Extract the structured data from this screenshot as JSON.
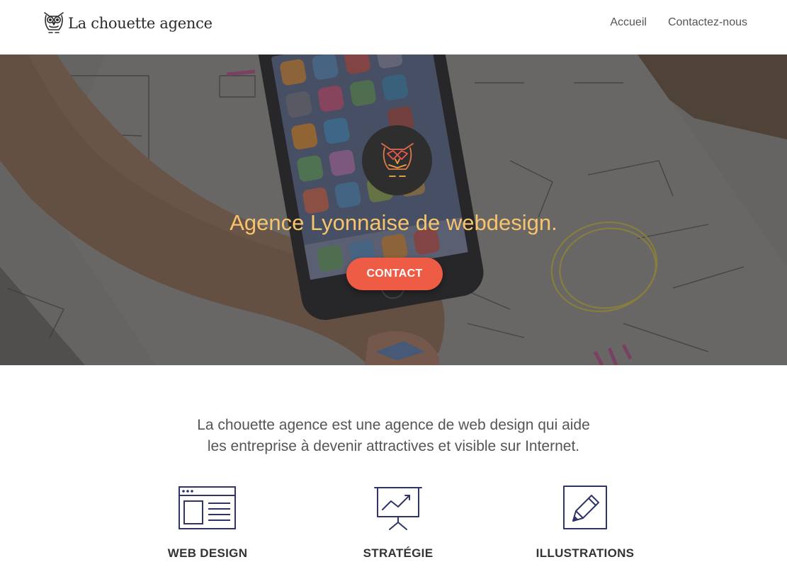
{
  "brand": {
    "name": "La chouette agence",
    "accent_color": "#ee5c45",
    "hero_title_color": "#f7c36b",
    "icon_color": "#2f3566"
  },
  "nav": {
    "items": [
      {
        "label": "Accueil"
      },
      {
        "label": "Contactez-nous"
      }
    ]
  },
  "hero": {
    "title": "Agence Lyonnaise de webdesign.",
    "cta_label": "CONTACT",
    "badge_icon": "owl-icon"
  },
  "intro": {
    "line1": "La chouette agence est une agence de web design qui aide",
    "line2": "les entreprise à devenir attractives et visible sur Internet."
  },
  "services": [
    {
      "title": "WEB DESIGN",
      "icon": "web-layout-icon"
    },
    {
      "title": "STRATÉGIE",
      "icon": "presentation-chart-icon"
    },
    {
      "title": "ILLUSTRATIONS",
      "icon": "pencil-icon"
    }
  ]
}
